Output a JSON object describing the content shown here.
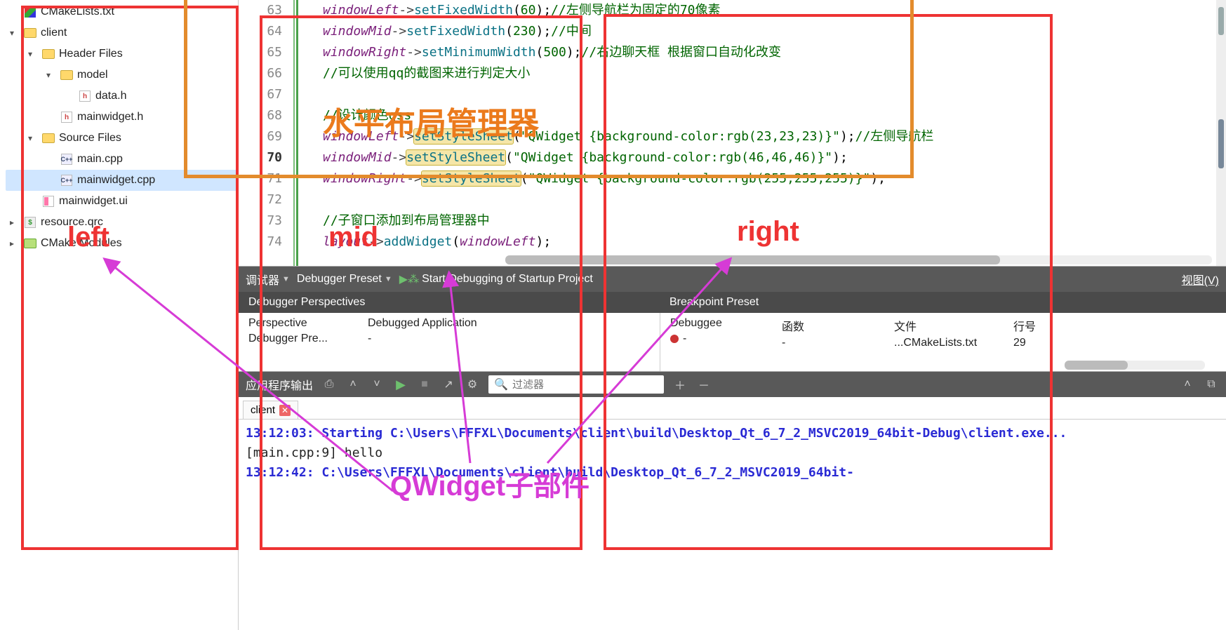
{
  "tree": {
    "items": [
      {
        "indent": 0,
        "chev": "",
        "icon": "cmake",
        "label": "CMakeLists.txt"
      },
      {
        "indent": 0,
        "chev": "▾",
        "icon": "folder",
        "label": "client"
      },
      {
        "indent": 1,
        "chev": "▾",
        "icon": "folder",
        "label": "Header Files"
      },
      {
        "indent": 2,
        "chev": "▾",
        "icon": "folder",
        "label": "model"
      },
      {
        "indent": 3,
        "chev": "",
        "icon": "h",
        "label": "data.h"
      },
      {
        "indent": 2,
        "chev": "",
        "icon": "h",
        "label": "mainwidget.h"
      },
      {
        "indent": 1,
        "chev": "▾",
        "icon": "folder",
        "label": "Source Files"
      },
      {
        "indent": 2,
        "chev": "",
        "icon": "cpp",
        "label": "main.cpp"
      },
      {
        "indent": 2,
        "chev": "",
        "icon": "cpp",
        "label": "mainwidget.cpp",
        "sel": true
      },
      {
        "indent": 1,
        "chev": "",
        "icon": "ui",
        "label": "mainwidget.ui"
      },
      {
        "indent": 0,
        "chev": "▸",
        "icon": "qrc",
        "label": "resource.qrc"
      },
      {
        "indent": 0,
        "chev": "▸",
        "icon": "cm",
        "label": "CMake Modules"
      }
    ]
  },
  "editor": {
    "lines": [
      {
        "n": "63",
        "html": "<span class='c-obj'>windowLeft</span><span class='c-op'>-&gt;</span><span class='c-fn'>setFixedWidth</span>(<span class='c-num'>60</span>);<span class='c-cmt'>//左侧导航栏为固定的70像素</span>"
      },
      {
        "n": "64",
        "html": "<span class='c-obj'>windowMid</span><span class='c-op'>-&gt;</span><span class='c-fn'>setFixedWidth</span>(<span class='c-num'>230</span>);<span class='c-cmt'>//中间</span>"
      },
      {
        "n": "65",
        "html": "<span class='c-obj'>windowRight</span><span class='c-op'>-&gt;</span><span class='c-fn'>setMinimumWidth</span>(<span class='c-num'>500</span>);<span class='c-cmt'>//右边聊天框 根据窗口自动化改变</span>"
      },
      {
        "n": "66",
        "html": "<span class='c-cmt'>//可以使用qq的截图来进行判定大小</span>"
      },
      {
        "n": "67",
        "html": ""
      },
      {
        "n": "68",
        "html": "<span class='c-cmt'>//设计颜色qss</span>"
      },
      {
        "n": "69",
        "html": "<span class='c-obj'>windowLeft</span><span class='c-op'>-&gt;</span><span class='c-fn c-highlight'>setStyleSheet</span>(<span class='c-str'>\"QWidget {background-color:rgb(23,23,23)}\"</span>);<span class='c-cmt'>//左侧导航栏</span>"
      },
      {
        "n": "70",
        "cur": true,
        "html": "<span class='c-obj'>windowMid</span><span class='c-op'>-&gt;</span><span class='c-fn c-highlight'>setStyleSheet</span>(<span class='c-str'>\"QWidget {background-color:rgb(46,46,46)}\"</span>);"
      },
      {
        "n": "71",
        "html": "<span class='c-obj'>windowRight</span><span class='c-op'>-&gt;</span><span class='c-fn c-highlight'>setStyleSheet</span>(<span class='c-str'>\"QWidget {background-color:rgb(255,255,255)}\"</span>);"
      },
      {
        "n": "72",
        "html": ""
      },
      {
        "n": "73",
        "html": "<span class='c-cmt'>//子窗口添加到布局管理器中</span>"
      },
      {
        "n": "74",
        "html": "<span class='c-obj'>layout</span><span class='c-op'>-&gt;</span><span class='c-fn'>addWidget</span>(<span class='c-obj'>windowLeft</span>);"
      }
    ]
  },
  "debugger": {
    "label": "调试器",
    "preset": "Debugger Preset",
    "start_label": "Start Debugging of Startup Project",
    "view_label": "视图(V)",
    "headers": {
      "left": "Debugger Perspectives",
      "right": "Breakpoint Preset"
    },
    "cols": {
      "perspective": "Perspective",
      "debugged_app": "Debugged Application",
      "debuggee": "Debuggee",
      "func": "函数",
      "file": "文件",
      "line": "行号"
    },
    "row": {
      "perspective": "Debugger Pre...",
      "debugged_app": "-",
      "debuggee": "-",
      "func": "-",
      "file": "...CMakeLists.txt",
      "line": "29"
    }
  },
  "output": {
    "title": "应用程序输出",
    "filter_placeholder": "过滤器",
    "tab": "client",
    "lines": [
      {
        "cls": "blue",
        "text": "13:12:03: Starting C:\\Users\\FFFXL\\Documents\\client\\build\\Desktop_Qt_6_7_2_MSVC2019_64bit-Debug\\client.exe..."
      },
      {
        "cls": "",
        "text": "[main.cpp:9] hello"
      },
      {
        "cls": "blue",
        "text": "13:12:42: C:\\Users\\FFFXL\\Documents\\client\\build\\Desktop_Qt_6_7_2_MSVC2019_64bit-"
      }
    ]
  },
  "annotations": {
    "orange_title": "水平布局管理器",
    "left": "left",
    "mid": "mid",
    "right": "right",
    "qwidget": "QWidget子部件"
  }
}
